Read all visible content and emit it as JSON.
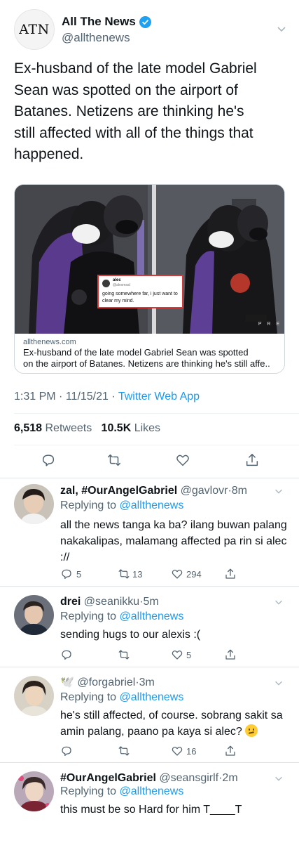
{
  "tweet": {
    "logo_text": "ATN",
    "display_name": "All The News",
    "handle": "@allthenews",
    "text": "Ex-husband of the late model Gabriel\nSean was spotted on the airport of\nBatanes. Netizens are thinking he's\nstill affected with all of the things that\nhappened.",
    "card": {
      "embedded_tweet": {
        "name": "alec",
        "handle": "@alexmsal",
        "text": "going somewhere far, i just want to clear my mind."
      },
      "watermark": "P R E",
      "domain": "allthenews.com",
      "title_line1": "Ex-husband of the late model Gabriel Sean was spotted",
      "title_line2": "on the airport of Batanes. Netizens are thinking he's still affe.."
    },
    "time": "1:31 PM",
    "date": "11/15/21",
    "separator": "·",
    "source": "Twitter Web App",
    "retweets": "6,518",
    "retweets_label": "Retweets",
    "likes": "10.5K",
    "likes_label": "Likes"
  },
  "replies": [
    {
      "name": "zal, #OurAngelGabriel",
      "handle": "@gavlovr",
      "time": "8m",
      "replying_label": "Replying to",
      "replying_to": "@allthenews",
      "text": "all the news tanga ka ba? ilang buwan palang nakakalipas, malamang affected pa rin si alec ://",
      "reply_count": "5",
      "retweet_count": "13",
      "like_count": "294"
    },
    {
      "name": "drei",
      "handle": "@seanikku",
      "time": "5m",
      "replying_label": "Replying to",
      "replying_to": "@allthenews",
      "text": "sending hugs to our alexis :(",
      "like_count": "5"
    },
    {
      "name": "🕊️",
      "handle": "@forgabriel",
      "time": "3m",
      "replying_label": "Replying to",
      "replying_to": "@allthenews",
      "text": "he's still affected, of course. sobrang sakit sa amin palang, paano pa kaya si alec?",
      "like_count": "16"
    },
    {
      "name": "#OurAngelGabriel",
      "handle": "@seansgirlf",
      "time": "2m",
      "replying_label": "Replying to",
      "replying_to": "@allthenews",
      "text": "this must be so Hard for him T____T"
    }
  ],
  "icons": {
    "reply": "speech-bubble-icon",
    "retweet": "retweet-arrows-icon",
    "like": "heart-icon",
    "share": "share-upload-icon",
    "more": "chevron-down-icon",
    "verified": "verified-badge-icon"
  },
  "colors": {
    "link": "#1d9bf0",
    "secondary_text": "#536471",
    "verified": "#1da1f2",
    "text": "#0f1419"
  }
}
